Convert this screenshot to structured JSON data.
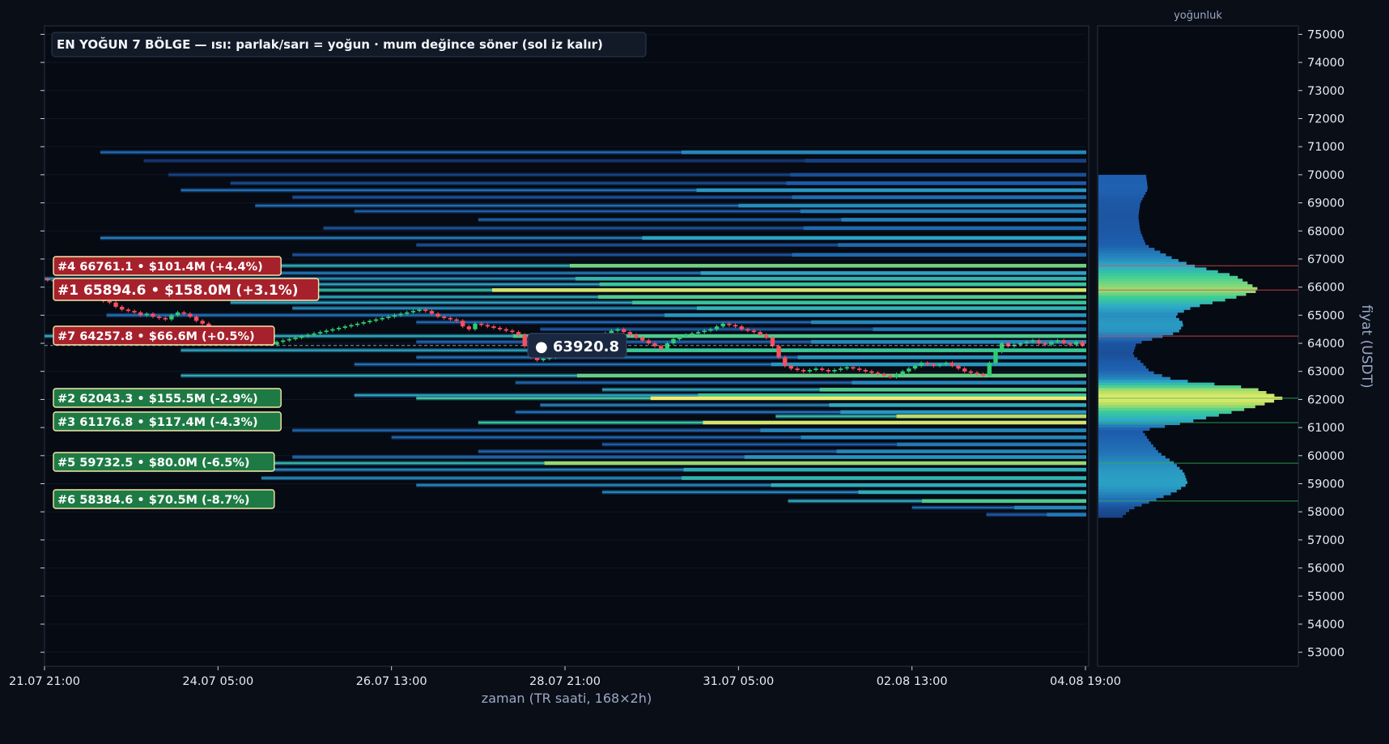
{
  "chart_data": {
    "type": "heatmap",
    "title": "EN YOĞUN 7 BÖLGE — ısı: parlak/sarı = yoğun · mum değince söner (sol iz kalır)",
    "xlabel": "zaman (TR saati, 168×2h)",
    "ylabel": "fiyat (USDT)",
    "profile_title": "yoğunluk",
    "ylim": [
      52500,
      75300
    ],
    "y_ticks": [
      53000,
      54000,
      55000,
      56000,
      57000,
      58000,
      59000,
      60000,
      61000,
      62000,
      63000,
      64000,
      65000,
      66000,
      67000,
      68000,
      69000,
      70000,
      71000,
      72000,
      73000,
      74000,
      75000
    ],
    "x_ticks": [
      "21.07 21:00",
      "24.07 05:00",
      "26.07 13:00",
      "28.07 21:00",
      "31.07 05:00",
      "02.08 13:00",
      "04.08 19:00"
    ],
    "x_tick_index": [
      0,
      28,
      56,
      84,
      112,
      140,
      168
    ],
    "bar_count": 168,
    "current_price": {
      "label": "● 63920.8",
      "value": 63920.8,
      "bar_index": 84
    },
    "zones": [
      {
        "rank": 1,
        "label": "#1  65894.6  •  $158.0M  (+3.1%)",
        "price": 65894.6,
        "volume_musd": 158.0,
        "side": "above"
      },
      {
        "rank": 2,
        "label": "#2  62043.3  •  $155.5M  (-2.9%)",
        "price": 62043.3,
        "volume_musd": 155.5,
        "side": "below"
      },
      {
        "rank": 3,
        "label": "#3  61176.8  •  $117.4M  (-4.3%)",
        "price": 61176.8,
        "volume_musd": 117.4,
        "side": "below"
      },
      {
        "rank": 4,
        "label": "#4  66761.1  •  $101.4M  (+4.4%)",
        "price": 66761.1,
        "volume_musd": 101.4,
        "side": "above"
      },
      {
        "rank": 5,
        "label": "#5  59732.5  •  $80.0M  (-6.5%)",
        "price": 59732.5,
        "volume_musd": 80.0,
        "side": "below"
      },
      {
        "rank": 6,
        "label": "#6  58384.6  •  $70.5M  (-8.7%)",
        "price": 58384.6,
        "volume_musd": 70.5,
        "side": "below"
      },
      {
        "rank": 7,
        "label": "#7  64257.8  •  $66.6M  (+0.5%)",
        "price": 64257.8,
        "volume_musd": 66.6,
        "side": "above"
      }
    ],
    "heat_levels": [
      {
        "price": 70800,
        "start_bar": 9,
        "intensity": 0.4
      },
      {
        "price": 70500,
        "start_bar": 16,
        "intensity": 0.12
      },
      {
        "price": 70000,
        "start_bar": 20,
        "intensity": 0.18
      },
      {
        "price": 69700,
        "start_bar": 30,
        "intensity": 0.25
      },
      {
        "price": 69450,
        "start_bar": 22,
        "intensity": 0.45
      },
      {
        "price": 69200,
        "start_bar": 40,
        "intensity": 0.3
      },
      {
        "price": 68900,
        "start_bar": 34,
        "intensity": 0.42
      },
      {
        "price": 68700,
        "start_bar": 50,
        "intensity": 0.35
      },
      {
        "price": 68400,
        "start_bar": 70,
        "intensity": 0.38
      },
      {
        "price": 68100,
        "start_bar": 45,
        "intensity": 0.3
      },
      {
        "price": 67750,
        "start_bar": 9,
        "intensity": 0.5
      },
      {
        "price": 67500,
        "start_bar": 60,
        "intensity": 0.3
      },
      {
        "price": 67150,
        "start_bar": 40,
        "intensity": 0.3
      },
      {
        "price": 66761.1,
        "start_bar": 22,
        "intensity": 0.8
      },
      {
        "price": 66500,
        "start_bar": 30,
        "intensity": 0.5
      },
      {
        "price": 66300,
        "start_bar": 0,
        "intensity": 0.6
      },
      {
        "price": 66100,
        "start_bar": 20,
        "intensity": 0.7
      },
      {
        "price": 65894.6,
        "start_bar": 16,
        "intensity": 0.95
      },
      {
        "price": 65650,
        "start_bar": 25,
        "intensity": 0.75
      },
      {
        "price": 65450,
        "start_bar": 30,
        "intensity": 0.7
      },
      {
        "price": 65250,
        "start_bar": 40,
        "intensity": 0.6
      },
      {
        "price": 65000,
        "start_bar": 10,
        "intensity": 0.45
      },
      {
        "price": 64750,
        "start_bar": 60,
        "intensity": 0.4
      },
      {
        "price": 64500,
        "start_bar": 80,
        "intensity": 0.35
      },
      {
        "price": 64257.8,
        "start_bar": 0,
        "intensity": 0.75
      },
      {
        "price": 64050,
        "start_bar": 60,
        "intensity": 0.4
      },
      {
        "price": 63750,
        "start_bar": 22,
        "intensity": 0.72
      },
      {
        "price": 63500,
        "start_bar": 60,
        "intensity": 0.45
      },
      {
        "price": 63250,
        "start_bar": 50,
        "intensity": 0.45
      },
      {
        "price": 62850,
        "start_bar": 22,
        "intensity": 0.78
      },
      {
        "price": 62600,
        "start_bar": 76,
        "intensity": 0.4
      },
      {
        "price": 62350,
        "start_bar": 90,
        "intensity": 0.75
      },
      {
        "price": 62150,
        "start_bar": 50,
        "intensity": 0.7
      },
      {
        "price": 62043.3,
        "start_bar": 60,
        "intensity": 1.0
      },
      {
        "price": 61800,
        "start_bar": 80,
        "intensity": 0.55
      },
      {
        "price": 61550,
        "start_bar": 76,
        "intensity": 0.45
      },
      {
        "price": 61400,
        "start_bar": 118,
        "intensity": 0.9
      },
      {
        "price": 61176.8,
        "start_bar": 70,
        "intensity": 0.95
      },
      {
        "price": 60900,
        "start_bar": 40,
        "intensity": 0.4
      },
      {
        "price": 60650,
        "start_bar": 56,
        "intensity": 0.4
      },
      {
        "price": 60400,
        "start_bar": 90,
        "intensity": 0.35
      },
      {
        "price": 60150,
        "start_bar": 70,
        "intensity": 0.4
      },
      {
        "price": 59950,
        "start_bar": 40,
        "intensity": 0.45
      },
      {
        "price": 59732.5,
        "start_bar": 20,
        "intensity": 0.85
      },
      {
        "price": 59500,
        "start_bar": 30,
        "intensity": 0.55
      },
      {
        "price": 59200,
        "start_bar": 35,
        "intensity": 0.6
      },
      {
        "price": 58950,
        "start_bar": 60,
        "intensity": 0.55
      },
      {
        "price": 58700,
        "start_bar": 90,
        "intensity": 0.55
      },
      {
        "price": 58384.6,
        "start_bar": 120,
        "intensity": 0.75
      },
      {
        "price": 58150,
        "start_bar": 140,
        "intensity": 0.4
      },
      {
        "price": 57900,
        "start_bar": 152,
        "intensity": 0.35
      }
    ],
    "candles_close": [
      66250,
      66200,
      66150,
      66000,
      65950,
      65850,
      65900,
      65750,
      65600,
      65500,
      65450,
      65300,
      65200,
      65150,
      65100,
      65000,
      65050,
      64950,
      64900,
      64850,
      65000,
      65100,
      65050,
      64950,
      64800,
      64700,
      64500,
      64400,
      64300,
      64250,
      64200,
      64150,
      64100,
      64050,
      64000,
      64000,
      63950,
      64050,
      64100,
      64150,
      64200,
      64250,
      64300,
      64350,
      64400,
      64450,
      64500,
      64550,
      64600,
      64650,
      64700,
      64750,
      64800,
      64850,
      64900,
      64950,
      65000,
      65050,
      65100,
      65150,
      65200,
      65150,
      65050,
      64950,
      64900,
      64850,
      64800,
      64600,
      64500,
      64700,
      64650,
      64600,
      64550,
      64500,
      64450,
      64400,
      64300,
      63900,
      63500,
      63400,
      63450,
      63500,
      63550,
      63600,
      63700,
      63800,
      63900,
      63950,
      64050,
      64200,
      64350,
      64450,
      64500,
      64400,
      64300,
      64200,
      64100,
      64000,
      63900,
      63800,
      64000,
      64150,
      64250,
      64300,
      64350,
      64400,
      64450,
      64500,
      64600,
      64700,
      64650,
      64600,
      64500,
      64450,
      64400,
      64300,
      64200,
      63900,
      63500,
      63200,
      63100,
      63050,
      63000,
      63050,
      63100,
      63050,
      63000,
      63050,
      63100,
      63150,
      63100,
      63050,
      63000,
      62950,
      62900,
      62850,
      62800,
      62900,
      63000,
      63100,
      63200,
      63300,
      63250,
      63200,
      63250,
      63300,
      63200,
      63100,
      63000,
      62950,
      62900,
      62850,
      63300,
      63700,
      64000,
      63900,
      63950,
      64000,
      64050,
      64100,
      64000,
      63950,
      64050,
      64100,
      64000,
      63950,
      64050,
      63920.8
    ],
    "profile": [
      {
        "price": 70000,
        "v": 0.25
      },
      {
        "price": 69500,
        "v": 0.26
      },
      {
        "price": 69000,
        "v": 0.22
      },
      {
        "price": 68500,
        "v": 0.21
      },
      {
        "price": 68000,
        "v": 0.22
      },
      {
        "price": 67500,
        "v": 0.25
      },
      {
        "price": 67000,
        "v": 0.4
      },
      {
        "price": 66761.1,
        "v": 0.5
      },
      {
        "price": 66400,
        "v": 0.72
      },
      {
        "price": 65894.6,
        "v": 0.85
      },
      {
        "price": 65600,
        "v": 0.7
      },
      {
        "price": 65300,
        "v": 0.5
      },
      {
        "price": 65000,
        "v": 0.4
      },
      {
        "price": 64700,
        "v": 0.45
      },
      {
        "price": 64400,
        "v": 0.42
      },
      {
        "price": 64000,
        "v": 0.2
      },
      {
        "price": 63600,
        "v": 0.18
      },
      {
        "price": 63300,
        "v": 0.23
      },
      {
        "price": 63000,
        "v": 0.27
      },
      {
        "price": 62700,
        "v": 0.4
      },
      {
        "price": 62400,
        "v": 0.82
      },
      {
        "price": 62043.3,
        "v": 0.97
      },
      {
        "price": 61700,
        "v": 0.8
      },
      {
        "price": 61400,
        "v": 0.6
      },
      {
        "price": 61176.8,
        "v": 0.45
      },
      {
        "price": 60900,
        "v": 0.23
      },
      {
        "price": 60500,
        "v": 0.27
      },
      {
        "price": 60100,
        "v": 0.32
      },
      {
        "price": 59732.5,
        "v": 0.4
      },
      {
        "price": 59400,
        "v": 0.45
      },
      {
        "price": 59000,
        "v": 0.47
      },
      {
        "price": 58700,
        "v": 0.4
      },
      {
        "price": 58384.6,
        "v": 0.28
      },
      {
        "price": 58100,
        "v": 0.17
      },
      {
        "price": 57800,
        "v": 0.12
      }
    ],
    "colors": {
      "background": "#0a0e16",
      "plot_bg": "#060a12",
      "axis_text": "#e6ebf5",
      "label_text": "#9aa8c8",
      "up": "#2ecc71",
      "down": "#ff4d5e",
      "zone_above": "#a6212c",
      "zone_below": "#1e7a44",
      "zone_border": "#f5e9a8",
      "price_box": "#1a2740"
    },
    "grid": true,
    "legend": "none"
  }
}
